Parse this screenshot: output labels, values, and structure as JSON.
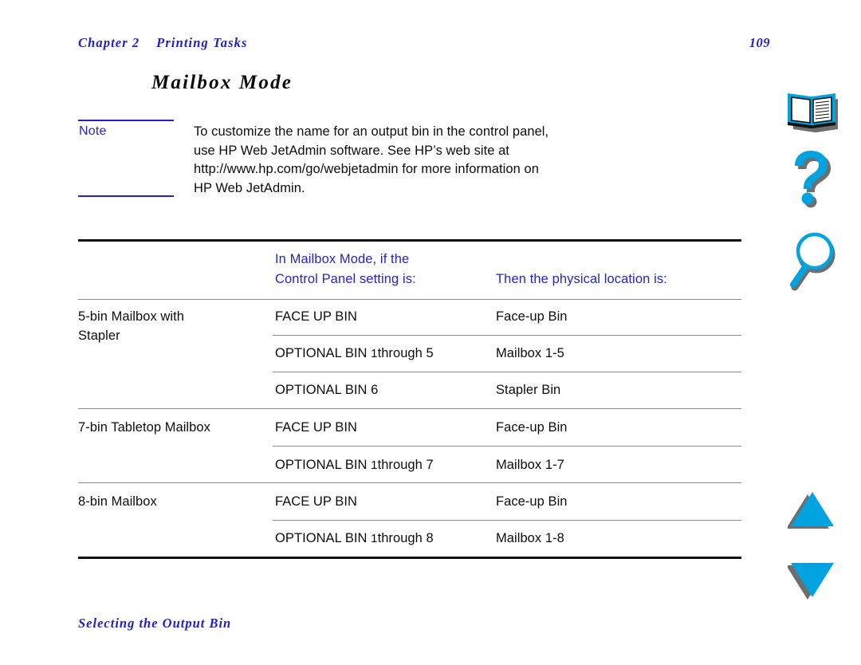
{
  "header": {
    "chapter": "Chapter 2    Printing Tasks",
    "page_number": "109"
  },
  "section": {
    "title": "Mailbox Mode"
  },
  "note": {
    "label": "Note",
    "lines": [
      "To customize the name for an output bin in the control panel,",
      "use HP Web JetAdmin software. See HP’s web site at",
      "http://www.hp.com/go/webjetadmin for more information on",
      "HP Web JetAdmin."
    ]
  },
  "table": {
    "headers": {
      "col_a": "",
      "col_b_line1": "In Mailbox Mode, if the",
      "col_b_line2": "Control Panel setting is:",
      "col_c": "Then the physical location is:"
    },
    "groups": [
      {
        "device_line1": "5-bin Mailbox with",
        "device_line2": "Stapler",
        "rows": [
          {
            "setting": "FACE UP BIN",
            "setting_prefix": "",
            "setting_num": "",
            "setting_suffix": "",
            "location": "Face-up Bin"
          },
          {
            "setting": "OPTIONAL BIN 1through 5",
            "setting_prefix": "OPTIONAL BIN ",
            "setting_num": "1",
            "setting_suffix": "through 5",
            "location": "Mailbox 1-5"
          },
          {
            "setting": "OPTIONAL BIN 6",
            "setting_prefix": "",
            "setting_num": "",
            "setting_suffix": "",
            "location": "Stapler Bin"
          }
        ]
      },
      {
        "device_line1": "7-bin Tabletop Mailbox",
        "device_line2": "",
        "rows": [
          {
            "setting": "FACE UP BIN",
            "setting_prefix": "",
            "setting_num": "",
            "setting_suffix": "",
            "location": "Face-up Bin"
          },
          {
            "setting": "OPTIONAL BIN 1through 7",
            "setting_prefix": "OPTIONAL BIN ",
            "setting_num": "1",
            "setting_suffix": "through 7",
            "location": "Mailbox 1-7"
          }
        ]
      },
      {
        "device_line1": "8-bin Mailbox",
        "device_line2": "",
        "rows": [
          {
            "setting": "FACE UP BIN",
            "setting_prefix": "",
            "setting_num": "",
            "setting_suffix": "",
            "location": "Face-up Bin"
          },
          {
            "setting": "OPTIONAL BIN 1through 8",
            "setting_prefix": "OPTIONAL BIN ",
            "setting_num": "1",
            "setting_suffix": "through 8",
            "location": "Mailbox 1-8"
          }
        ]
      }
    ]
  },
  "footer": {
    "text": "Selecting the Output Bin"
  },
  "nav_rail": {
    "items": [
      {
        "icon": "book-icon",
        "label": "Contents"
      },
      {
        "icon": "question-mark-icon",
        "label": "Help"
      },
      {
        "icon": "magnifier-icon",
        "label": "Search"
      },
      {
        "icon": "triangle-up-icon",
        "label": "Previous page"
      },
      {
        "icon": "triangle-down-icon",
        "label": "Next page"
      }
    ]
  },
  "colors": {
    "link_blue": "#2020CC",
    "heading_blue": "#2424CC",
    "icon_cyan": "#00A2E0",
    "icon_shadow": "#6E6E6E",
    "rule_dark": "#111111",
    "rule_light": "#8c8c8c",
    "text_black": "#0d0d0d",
    "page_bg": "#ffffff"
  }
}
